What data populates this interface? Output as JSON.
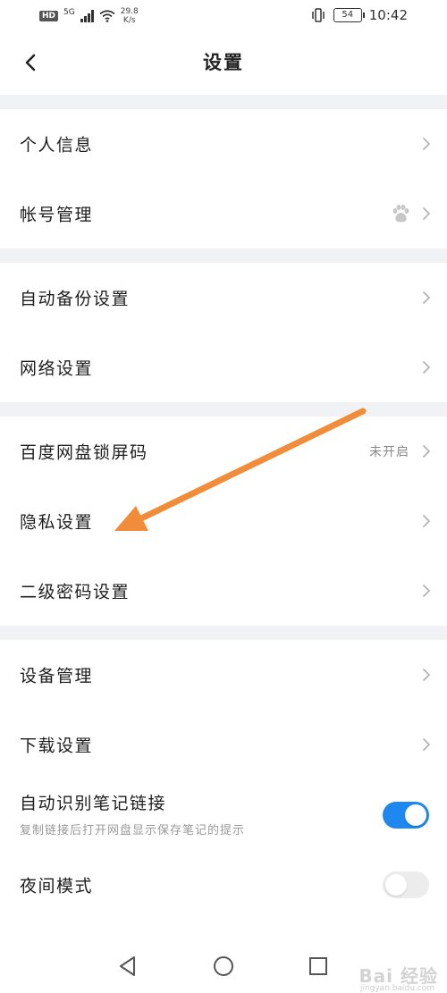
{
  "status_bar": {
    "hd": "HD",
    "network": "5G",
    "speed_value": "29.8",
    "speed_unit": "K/s",
    "battery": "54",
    "time": "10:42"
  },
  "header": {
    "title": "设置"
  },
  "sections": [
    {
      "items": [
        {
          "label": "个人信息"
        },
        {
          "label": "帐号管理",
          "icon": "paw-icon"
        }
      ]
    },
    {
      "items": [
        {
          "label": "自动备份设置"
        },
        {
          "label": "网络设置"
        }
      ]
    },
    {
      "items": [
        {
          "label": "百度网盘锁屏码",
          "value": "未开启"
        },
        {
          "label": "隐私设置"
        },
        {
          "label": "二级密码设置"
        }
      ]
    },
    {
      "items": [
        {
          "label": "设备管理"
        },
        {
          "label": "下载设置"
        },
        {
          "label": "自动识别笔记链接",
          "subtitle": "复制链接后打开网盘显示保存笔记的提示",
          "toggle": true
        },
        {
          "label": "夜间模式",
          "toggle": false
        }
      ]
    }
  ],
  "watermark": {
    "brand": "Bai 经验",
    "url": "jingyan.baidu.com"
  },
  "colors": {
    "accent": "#1f88f0",
    "section_gap": "#f1f2f5",
    "annotation_arrow": "#f08c3a"
  }
}
